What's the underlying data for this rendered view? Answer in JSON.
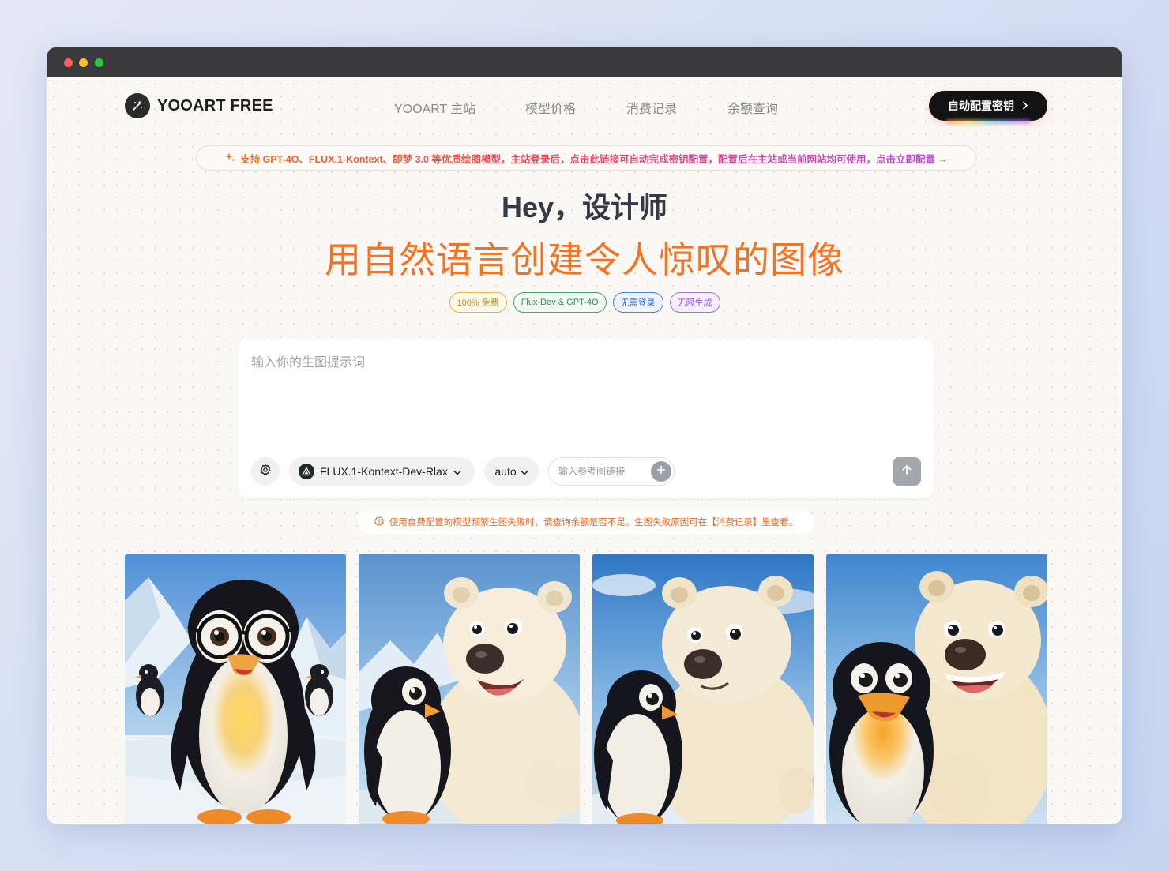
{
  "brand": {
    "name": "YOOART FREE"
  },
  "nav": [
    {
      "label": "YOOART 主站"
    },
    {
      "label": "模型价格"
    },
    {
      "label": "消费记录"
    },
    {
      "label": "余额查询"
    }
  ],
  "cta": {
    "label": "自动配置密钥"
  },
  "banner": {
    "text": "支持 GPT-4O、FLUX.1-Kontext、即梦 3.0 等优质绘图模型，主站登录后，点击此链接可自动完成密钥配置，配置后在主站或当前网站均可使用，点击立即配置 →"
  },
  "hero": {
    "greeting": "Hey，设计师",
    "headline": "用自然语言创建令人惊叹的图像"
  },
  "tags": [
    {
      "label": "100% 免费"
    },
    {
      "label": "Flux-Dev & GPT-4O"
    },
    {
      "label": "无需登录"
    },
    {
      "label": "无限生成"
    }
  ],
  "prompt": {
    "placeholder": "输入你的生图提示词",
    "value": "",
    "model": "FLUX.1-Kontext-Dev-Rlax",
    "ratio": "auto",
    "reference_placeholder": "输入参考图链接"
  },
  "notice": {
    "text": "使用自费配置的模型频繁生图失败时，请查询余额是否不足，生图失败原因可在【消费记录】里查看。"
  },
  "colors": {
    "accent": "#f37324",
    "cta_bg": "#131313",
    "heading": "#353a44"
  },
  "icons": {
    "logo": "magic-wand-icon",
    "banner": "sparkle-icon",
    "settings": "gear-icon",
    "model": "triangle-logo-icon",
    "dropdown": "chevron-down-icon",
    "add": "plus-icon",
    "send": "arrow-up-icon",
    "notice": "info-icon"
  }
}
